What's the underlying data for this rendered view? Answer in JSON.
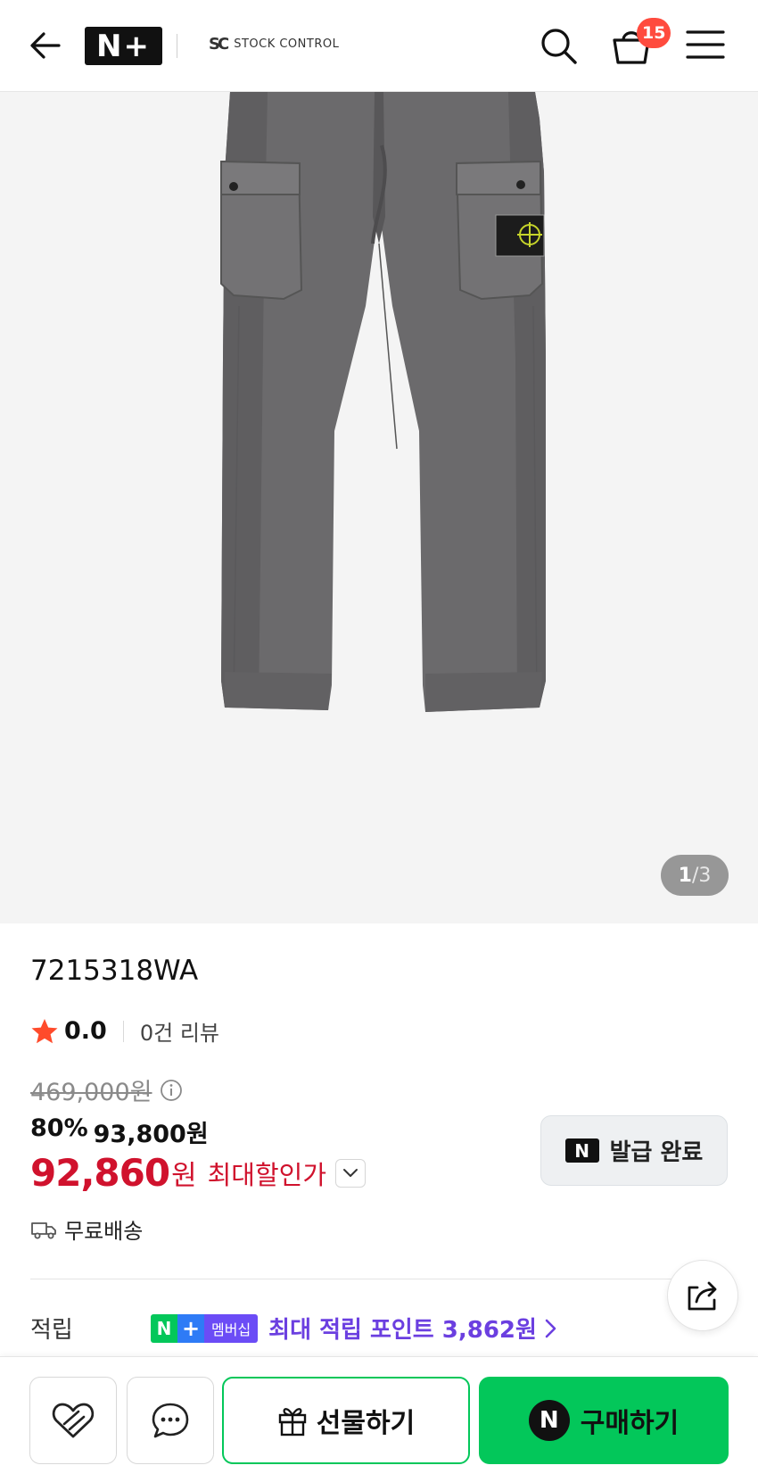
{
  "header": {
    "logo_text": "N+",
    "brand_mark": "SC",
    "brand_name": "STOCK CONTROL",
    "cart_count": "15"
  },
  "gallery": {
    "current": "1",
    "separator": "/",
    "total": "3"
  },
  "product": {
    "title": "7215318WA",
    "rating": "0.0",
    "reviews": "0건 리뷰",
    "original_price": "469,000원",
    "discount_rate": "80%",
    "sale_price": "93,800원",
    "max_price": "92,860",
    "max_price_unit": "원",
    "max_price_label": "최대할인가",
    "coupon_logo": "N",
    "coupon_label": "발급 완료",
    "shipping": "무료배송",
    "points_label": "적립",
    "membership_n": "N",
    "membership_plus": "+",
    "membership_label": "멤버십",
    "points_text": "최대 적립 포인트 3,862원"
  },
  "bottom_bar": {
    "gift_label": "선물하기",
    "buy_logo": "N",
    "buy_label": "구매하기"
  },
  "colors": {
    "accent_green": "#03c75a",
    "price_red": "#d0122d",
    "points_purple": "#6b3fe0",
    "badge_red": "#ff4b3e"
  }
}
